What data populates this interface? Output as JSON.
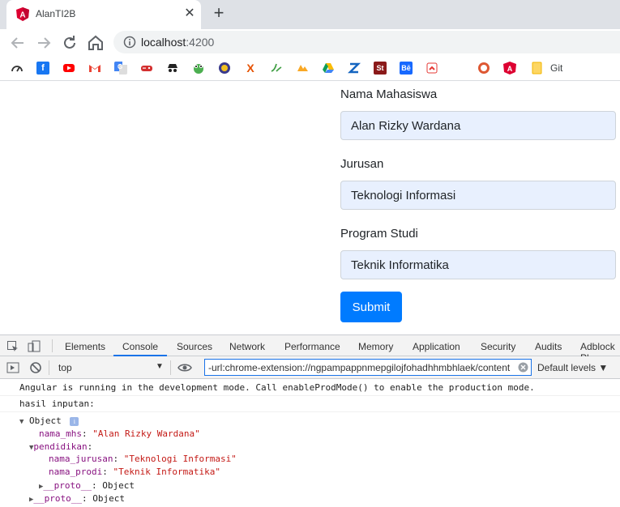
{
  "browser": {
    "tab_title": "AlanTI2B",
    "tab_close": "✕",
    "new_tab": "+",
    "url_host": "localhost",
    "url_port": ":4200"
  },
  "bookmarks": {
    "git_label": "Git"
  },
  "form": {
    "nama_label": "Nama Mahasiswa",
    "nama_value": "Alan Rizky Wardana",
    "jurusan_label": "Jurusan",
    "jurusan_value": "Teknologi Informasi",
    "prodi_label": "Program Studi",
    "prodi_value": "Teknik Informatika",
    "submit_label": "Submit"
  },
  "devtools": {
    "tabs": [
      "Elements",
      "Console",
      "Sources",
      "Network",
      "Performance",
      "Memory",
      "Application",
      "Security",
      "Audits",
      "Adblock Pl"
    ],
    "context": "top",
    "filter_value": "-url:chrome-extension://ngpampappnmepgilojfohadhhmbhlaek/content",
    "levels": "Default levels ▼"
  },
  "console": {
    "line1": "Angular is running in the development mode. Call enableProdMode() to enable the production mode.",
    "line2": "hasil inputan:",
    "object": "Object",
    "nama_mhs_key": "nama_mhs",
    "nama_mhs_val": "\"Alan Rizky Wardana\"",
    "pendidikan_key": "pendidikan",
    "nama_jurusan_key": "nama_jurusan",
    "nama_jurusan_val": "\"Teknologi Informasi\"",
    "nama_prodi_key": "nama_prodi",
    "nama_prodi_val": "\"Teknik Informatika\"",
    "proto_key": "__proto__",
    "proto_val": "Object"
  }
}
